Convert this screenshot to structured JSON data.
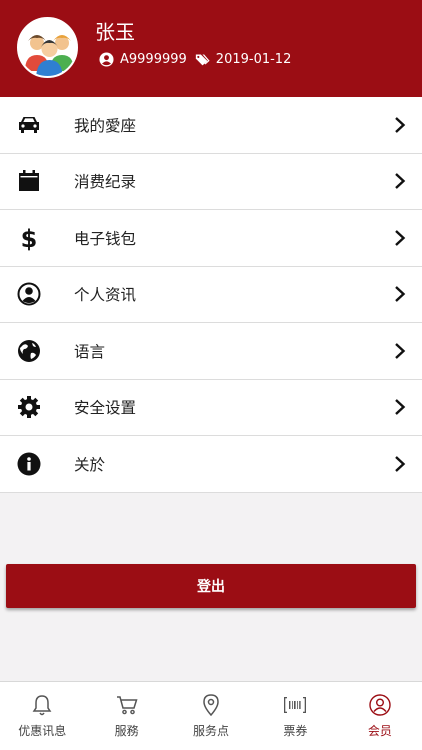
{
  "header": {
    "user_name": "张玉",
    "member_id": "A9999999",
    "date": "2019-01-12"
  },
  "menu": [
    {
      "label": "我的愛座",
      "icon": "car-icon"
    },
    {
      "label": "消费纪录",
      "icon": "calendar-icon"
    },
    {
      "label": "电子钱包",
      "icon": "dollar-icon"
    },
    {
      "label": "个人资讯",
      "icon": "user-circle-icon"
    },
    {
      "label": "语言",
      "icon": "globe-icon"
    },
    {
      "label": "安全设置",
      "icon": "gear-icon"
    },
    {
      "label": "关於",
      "icon": "info-icon"
    }
  ],
  "logout_label": "登出",
  "tabs": [
    {
      "label": "优惠讯息",
      "icon": "bell-icon"
    },
    {
      "label": "服務",
      "icon": "cart-icon"
    },
    {
      "label": "服务点",
      "icon": "location-pin-icon"
    },
    {
      "label": "票券",
      "icon": "barcode-icon"
    },
    {
      "label": "会员",
      "icon": "member-icon",
      "active": true
    }
  ],
  "colors": {
    "brand": "#9b0d14",
    "background": "#f3f2f3",
    "tab_active": "#9b0d14"
  }
}
